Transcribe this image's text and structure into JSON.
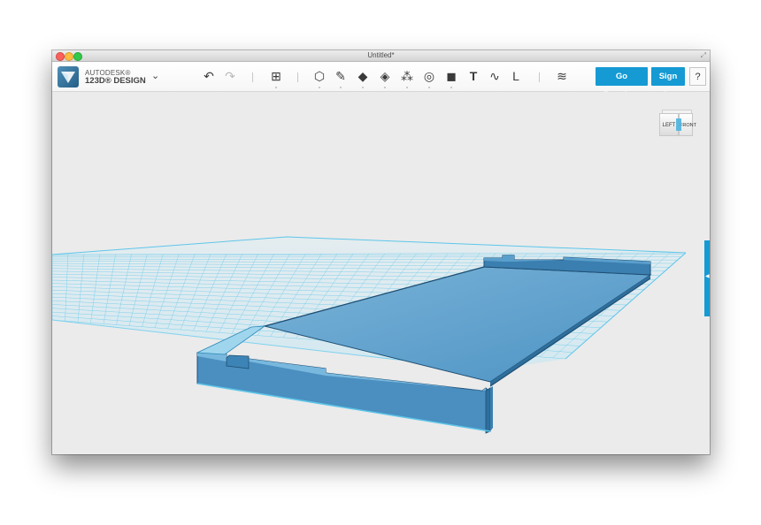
{
  "window": {
    "title": "Untitled*"
  },
  "toolbar": {
    "brand_line1": "AUTODESK®",
    "brand_line2": "123D® DESIGN",
    "menu_icon": "chevron-down-icon",
    "tools": [
      {
        "name": "undo-icon",
        "glyph": "↶"
      },
      {
        "name": "redo-icon",
        "glyph": "↷"
      },
      {
        "name": "add-primitive-icon",
        "glyph": "⊞"
      },
      {
        "name": "sketch-icon",
        "glyph": "⬡"
      },
      {
        "name": "construct-icon",
        "glyph": "✎"
      },
      {
        "name": "modify-icon",
        "glyph": "◆"
      },
      {
        "name": "pattern-icon",
        "glyph": "⁂"
      },
      {
        "name": "grouping-icon",
        "glyph": "⚇"
      },
      {
        "name": "snap-icon",
        "glyph": "◎"
      },
      {
        "name": "combine-icon",
        "glyph": "◼"
      },
      {
        "name": "text-icon",
        "glyph": "T"
      },
      {
        "name": "measure-icon",
        "glyph": "∿"
      },
      {
        "name": "materials-icon",
        "glyph": "L"
      },
      {
        "name": "layers-icon",
        "glyph": "≋"
      }
    ],
    "go_premium_label": "Go Premium",
    "sign_in_label": "Sign In",
    "help_label": "?"
  },
  "viewcube": {
    "left_label": "LEFT",
    "front_label": "FRONT"
  },
  "colors": {
    "accent": "#159ad3",
    "grid": "#5ec6ea",
    "model_fill": "#4a8fc0",
    "model_edge": "#1f4f74"
  }
}
